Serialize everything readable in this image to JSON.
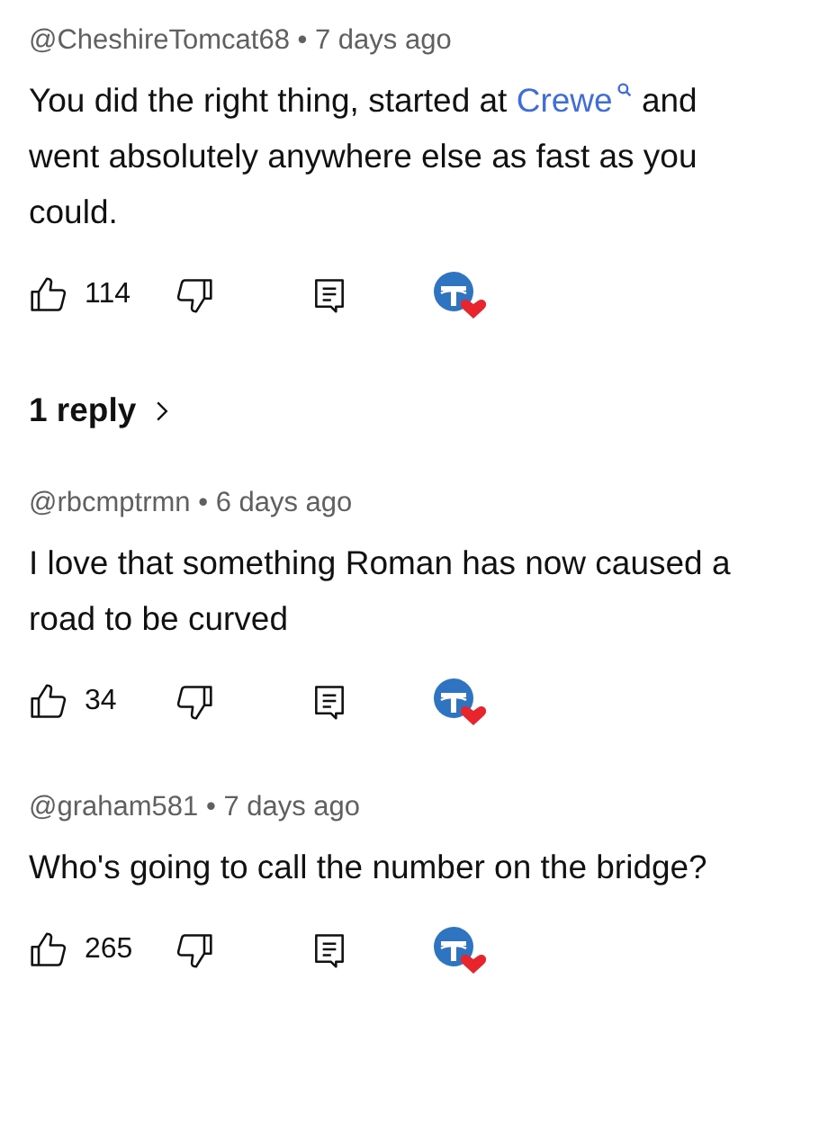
{
  "comments": [
    {
      "author": "@CheshireTomcat68",
      "separator": "•",
      "time": "7 days ago",
      "body": [
        {
          "kind": "text",
          "text": "You did the right thing, started at "
        },
        {
          "kind": "link",
          "text": "Crewe"
        },
        {
          "kind": "text",
          "text": " and went absolutely anywhere else as fast as you could."
        }
      ],
      "likes": "114",
      "hearted": true,
      "replies": "1 reply"
    },
    {
      "author": "@rbcmptrmn",
      "separator": "•",
      "time": "6 days ago",
      "body": [
        {
          "kind": "text",
          "text": "I love that something Roman has now caused a road to be curved"
        }
      ],
      "likes": "34",
      "hearted": true
    },
    {
      "author": "@graham581",
      "separator": "•",
      "time": "7 days ago",
      "body": [
        {
          "kind": "text",
          "text": "Who's going to call the number on the bridge?"
        }
      ],
      "likes": "265",
      "hearted": true
    }
  ]
}
